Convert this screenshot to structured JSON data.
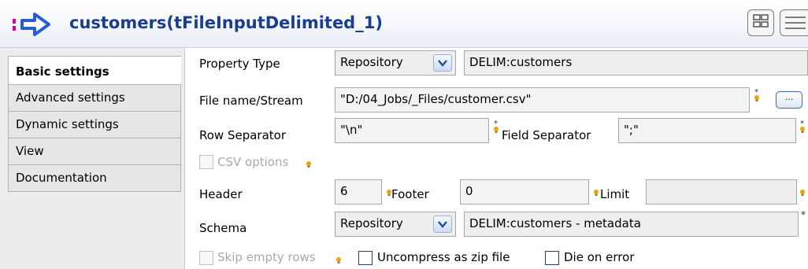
{
  "header": {
    "title": "customers(tFileInputDelimited_1)"
  },
  "sidebar": {
    "tabs": [
      {
        "label": "Basic settings",
        "active": true
      },
      {
        "label": "Advanced settings",
        "active": false
      },
      {
        "label": "Dynamic settings",
        "active": false
      },
      {
        "label": "View",
        "active": false
      },
      {
        "label": "Documentation",
        "active": false
      }
    ]
  },
  "form": {
    "property_type": {
      "label": "Property Type",
      "combo": "Repository",
      "value": "DELIM:customers"
    },
    "file_name": {
      "label": "File name/Stream",
      "value": "\"D:/04_Jobs/_Files/customer.csv\"",
      "browse_label": "..."
    },
    "row_separator": {
      "label": "Row Separator",
      "value": "\"\\n\""
    },
    "field_separator": {
      "label": "Field Separator",
      "value": "\";\""
    },
    "csv_options": {
      "label": "CSV options",
      "checked": false,
      "enabled": false
    },
    "header": {
      "label": "Header",
      "value": "6"
    },
    "footer": {
      "label": "Footer",
      "value": "0"
    },
    "limit": {
      "label": "Limit",
      "value": ""
    },
    "schema": {
      "label": "Schema",
      "combo": "Repository",
      "value": "DELIM:customers - metadata"
    },
    "skip_empty_rows": {
      "label": "Skip empty rows",
      "checked": false,
      "enabled": false
    },
    "uncompress_zip": {
      "label": "Uncompress as zip file",
      "checked": false
    },
    "die_on_error": {
      "label": "Die on error",
      "checked": false
    }
  },
  "colors": {
    "title": "#1a3d8f",
    "icon_arrow": "#2a5bd7",
    "icon_marker": "#d6009a",
    "bulb": "#f0a400"
  }
}
